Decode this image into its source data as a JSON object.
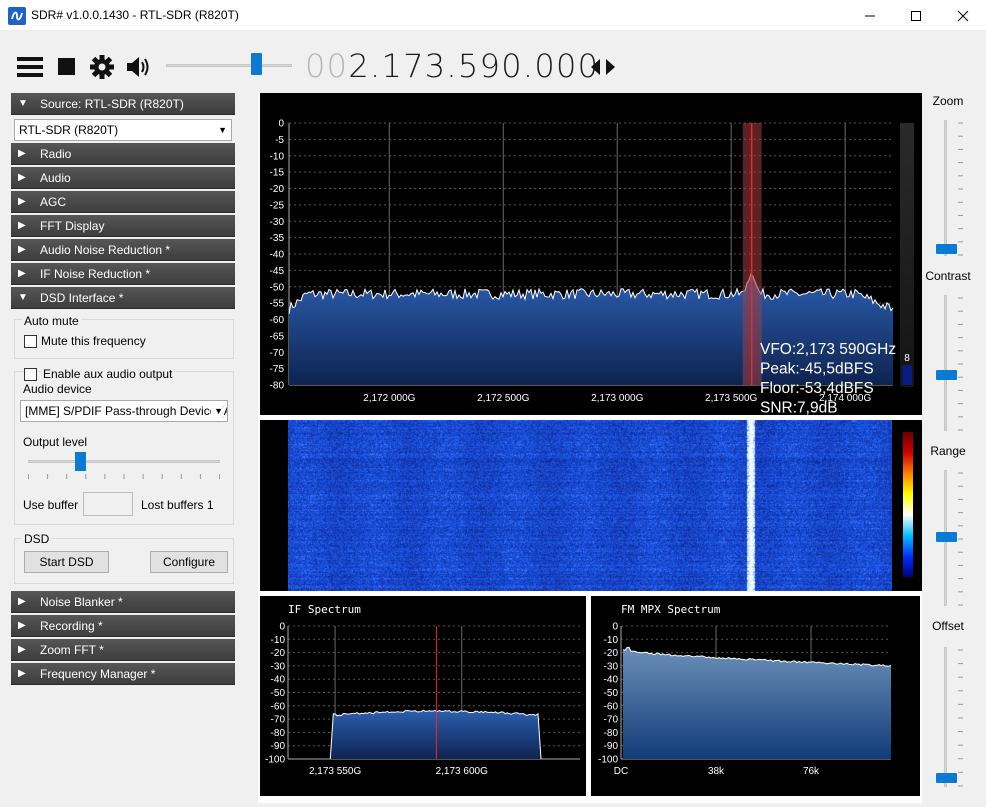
{
  "window": {
    "title": "SDR# v1.0.0.1430 - RTL-SDR (R820T)"
  },
  "toolbar": {
    "freq_lead": "00",
    "freq_main": "2.173.590.000"
  },
  "sidebar": {
    "source_header": "Source: RTL-SDR (R820T)",
    "source_select": "RTL-SDR (R820T)",
    "headers": [
      "Radio",
      "Audio",
      "AGC",
      "FFT Display",
      "Audio Noise Reduction *",
      "IF Noise Reduction *",
      "DSD Interface *"
    ],
    "dsd": {
      "auto_mute_legend": "Auto mute",
      "mute_label": "Mute this frequency",
      "aux_label": "Enable aux audio output",
      "audio_device_label": "Audio device",
      "audio_device_value": "[MME] S/PDIF Pass-through Device (A",
      "output_level_label": "Output level",
      "output_level": 0.27,
      "use_buffer_label": "Use buffer",
      "lost_buffers_label": "Lost buffers 1",
      "dsd_legend": "DSD",
      "start_label": "Start DSD",
      "configure_label": "Configure"
    },
    "bottom_headers": [
      "Noise Blanker *",
      "Recording *",
      "Zoom FFT *",
      "Frequency Manager *"
    ]
  },
  "right": {
    "zoom": "Zoom",
    "contrast": "Contrast",
    "range": "Range",
    "offset": "Offset"
  },
  "colors": {
    "accent": "#0a7ad4",
    "spectrum_fill": "#1f4f9a",
    "marker": "#e02020"
  },
  "chart_data": [
    {
      "type": "area",
      "name": "main-spectrum",
      "y_ticks": [
        "0",
        "-5",
        "-10",
        "-15",
        "-20",
        "-25",
        "-30",
        "-35",
        "-40",
        "-45",
        "-50",
        "-55",
        "-60",
        "-65",
        "-70",
        "-75",
        "-80"
      ],
      "ylim": [
        -80,
        0
      ],
      "x_ticks": [
        "2,172 000G",
        "2,172 500G",
        "2,173 000G",
        "2,173 500G",
        "2,174 000G"
      ],
      "x_tick_values": [
        2172.0,
        2172.5,
        2173.0,
        2173.5,
        2174.0
      ],
      "xlim": [
        2171.56,
        2174.21
      ],
      "peak": {
        "x": 2173.59,
        "y": -45.5
      },
      "floor": -53.4,
      "info": [
        "VFO:2,173 590GHz",
        "Peak:-45,5dBFS",
        "Floor:-53,4dBFS",
        "SNR:7,9dB"
      ],
      "level_meter_value": "8"
    },
    {
      "type": "heatmap",
      "name": "waterfall",
      "signal_x": 2173.59
    },
    {
      "type": "area",
      "name": "if-spectrum",
      "title": "IF Spectrum",
      "y_ticks": [
        "0",
        "-10",
        "-20",
        "-30",
        "-40",
        "-50",
        "-60",
        "-70",
        "-80",
        "-90",
        "-100"
      ],
      "ylim": [
        -100,
        0
      ],
      "x_ticks": [
        "2,173 550G",
        "2,173 600G"
      ],
      "x_tick_values": [
        2173.55,
        2173.6
      ],
      "xlim": [
        2173.5314,
        2173.6467
      ],
      "passband": [
        2173.5493,
        2173.6301
      ],
      "level": -67,
      "marker_x": 2173.59
    },
    {
      "type": "area",
      "name": "fm-mpx-spectrum",
      "title": "FM MPX Spectrum",
      "y_ticks": [
        "0",
        "-10",
        "-20",
        "-30",
        "-40",
        "-50",
        "-60",
        "-70",
        "-80",
        "-90",
        "-100"
      ],
      "ylim": [
        -100,
        0
      ],
      "x_ticks": [
        "DC",
        "38k",
        "76k"
      ],
      "x_tick_values": [
        0,
        38,
        76
      ],
      "xlim": [
        0,
        108
      ],
      "start_level": -18,
      "end_level": -30
    }
  ]
}
